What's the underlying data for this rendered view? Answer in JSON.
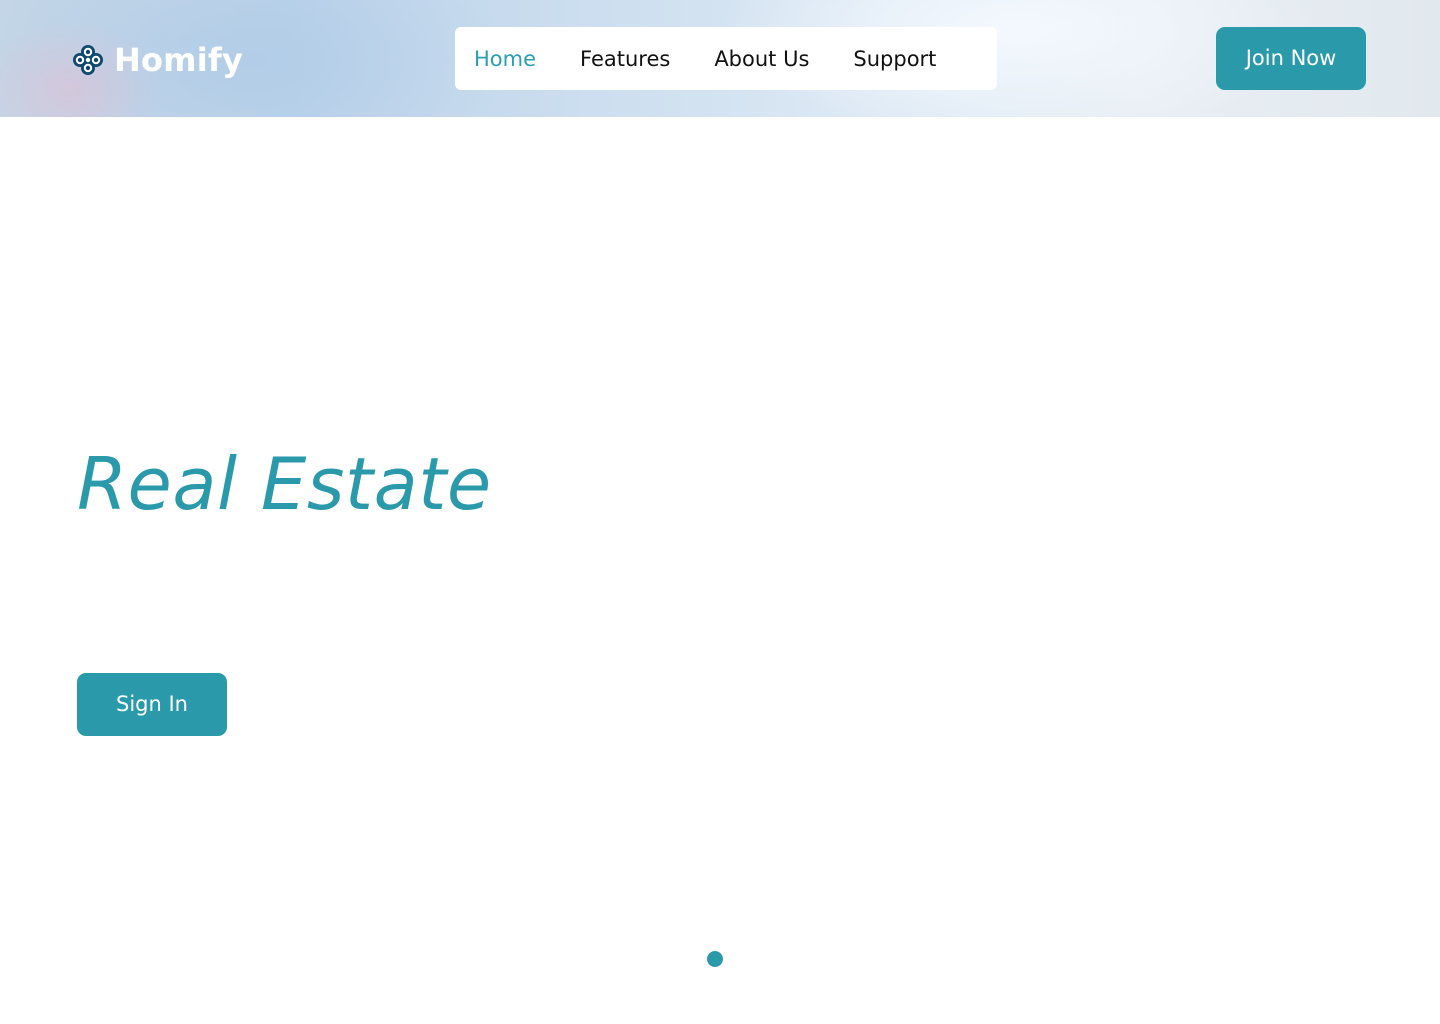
{
  "brand": {
    "name": "Homify",
    "logo_icon": "quatrefoil-logo-icon",
    "logo_icon_color": "#0f4a6e"
  },
  "nav": {
    "items": [
      {
        "label": "Home",
        "active": true
      },
      {
        "label": "Features",
        "active": false
      },
      {
        "label": "About Us",
        "active": false
      },
      {
        "label": "Support",
        "active": false
      }
    ]
  },
  "header": {
    "join_label": "Join Now"
  },
  "hero": {
    "title": "Real Estate",
    "signin_label": "Sign In"
  },
  "carousel": {
    "dot_count": 1,
    "active_index": 0
  },
  "colors": {
    "accent": "#2a9aab",
    "text": "#111111",
    "white": "#ffffff"
  }
}
